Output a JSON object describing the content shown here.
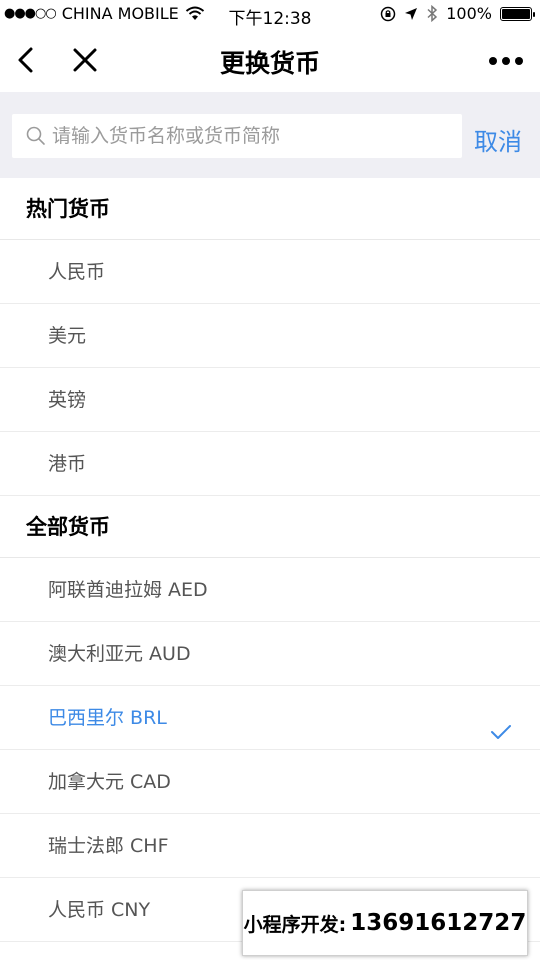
{
  "status_bar": {
    "signal": "●●●○○",
    "carrier": "CHINA MOBILE",
    "time": "下午12:38",
    "battery": "100%"
  },
  "nav": {
    "title": "更换货币"
  },
  "search": {
    "placeholder": "请输入货币名称或货币简称",
    "value": "",
    "cancel_label": "取消"
  },
  "sections": {
    "hot": {
      "header": "热门货币",
      "items": [
        "人民币",
        "美元",
        "英镑",
        "港币"
      ]
    },
    "all": {
      "header": "全部货币",
      "items": [
        "阿联酋迪拉姆 AED",
        "澳大利亚元 AUD",
        "巴西里尔 BRL",
        "加拿大元 CAD",
        "瑞士法郎 CHF",
        "人民币 CNY"
      ],
      "selected_index": 2
    }
  },
  "colors": {
    "accent": "#3d8ae6",
    "search_bg": "#efeff4"
  },
  "badge": {
    "label": "小程序开发:",
    "phone": "13691612727"
  }
}
